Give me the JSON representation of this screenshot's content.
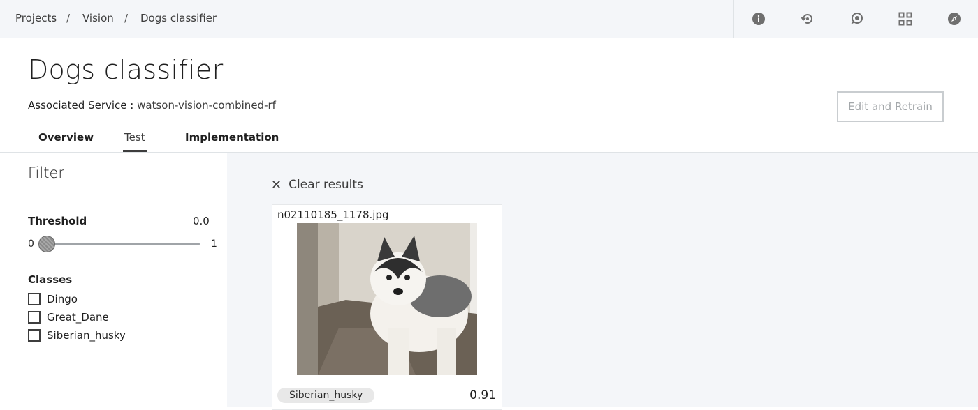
{
  "breadcrumb": {
    "items": [
      "Projects",
      "Vision",
      "Dogs classifier"
    ],
    "separator": "/"
  },
  "toolbar": {
    "icons": [
      "info-icon",
      "retrain-history-icon",
      "chat-icon",
      "grid-apps-icon",
      "compass-icon"
    ]
  },
  "header": {
    "title": "Dogs classifier",
    "service_label": "Associated Service : ",
    "service_value": "watson-vision-combined-rf",
    "edit_button": "Edit and Retrain"
  },
  "tabs": [
    {
      "label": "Overview",
      "active": false
    },
    {
      "label": "Test",
      "active": true
    },
    {
      "label": "Implementation",
      "active": false
    }
  ],
  "filter": {
    "title": "Filter",
    "threshold_label": "Threshold",
    "threshold_value": "0.0",
    "slider_min": "0",
    "slider_max": "1",
    "slider_level": 0.0,
    "classes_label": "Classes",
    "classes": [
      {
        "label": "Dingo",
        "checked": false
      },
      {
        "label": "Great_Dane",
        "checked": false
      },
      {
        "label": "Siberian_husky",
        "checked": false
      }
    ]
  },
  "results": {
    "clear_label": "Clear results",
    "card": {
      "filename": "n02110185_1178.jpg",
      "class_tag": "Siberian_husky",
      "score": "0.91"
    }
  },
  "colors": {
    "topbar_bg": "#f4f6f9",
    "results_bg": "#f4f6f9",
    "button_border": "#c9cdd0",
    "text": "#1f1f1f"
  }
}
